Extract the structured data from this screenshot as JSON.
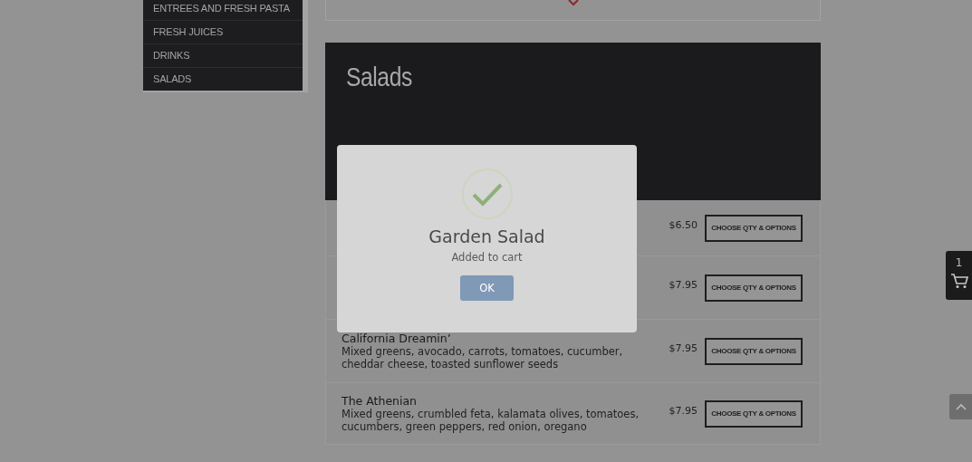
{
  "sidebar": {
    "items": [
      {
        "label": "ENTREES AND FRESH PASTA"
      },
      {
        "label": "FRESH JUICES"
      },
      {
        "label": "DRINKS"
      },
      {
        "label": "SALADS"
      }
    ]
  },
  "section": {
    "title": "Salads"
  },
  "menu_items": [
    {
      "price": "$6.50",
      "button": "CHOOSE QTY & OPTIONS"
    },
    {
      "price": "$7.95",
      "button": "CHOOSE QTY & OPTIONS"
    },
    {
      "name": "California Dreamin’",
      "description": "Mixed greens, avocado, carrots, tomatoes, cucumber, cheddar cheese, toasted sunflower seeds",
      "price": "$7.95",
      "button": "CHOOSE QTY & OPTIONS"
    },
    {
      "name": "The Athenian",
      "description": "Mixed greens, crumbled feta, kalamata olives, tomatoes, cucumbers, green peppers, red onion, oregano",
      "price": "$7.95",
      "button": "CHOOSE QTY & OPTIONS"
    }
  ],
  "dialog": {
    "title": "Garden Salad",
    "message": "Added to cart",
    "button": "OK"
  },
  "cart": {
    "count": "1"
  }
}
